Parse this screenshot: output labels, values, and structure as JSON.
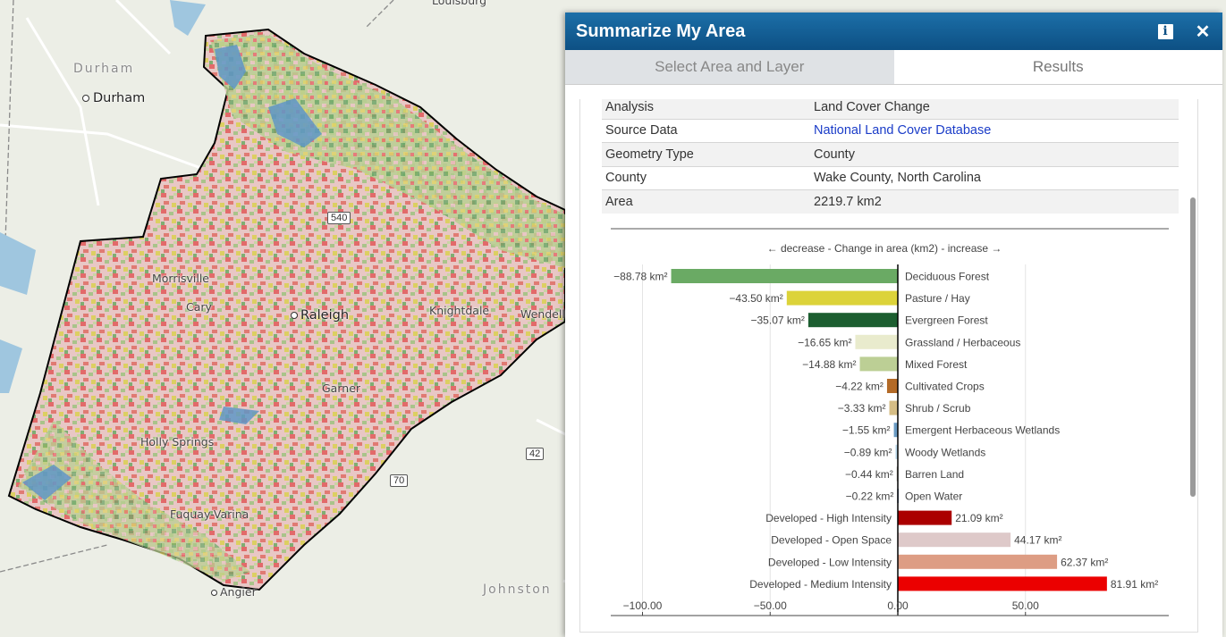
{
  "map": {
    "labels": {
      "durham_region": "Durham",
      "durham_city": "Durham",
      "louisburg": "Louisburg",
      "morrisville": "Morrisville",
      "cary": "Cary",
      "raleigh": "Raleigh",
      "knightdale": "Knightdale",
      "wendell": "Wendell",
      "garner": "Garner",
      "holly_springs": "Holly Springs",
      "fuquay_varina": "Fuquay-Varina",
      "angier": "Angier",
      "johnston": "Johnston"
    },
    "shields": {
      "i540": "540",
      "us70": "70",
      "nc42": "42"
    }
  },
  "panel": {
    "title": "Summarize My Area",
    "info_icon": "info-icon",
    "close_icon": "close-icon",
    "tabs": [
      {
        "label": "Select Area and Layer",
        "active": false
      },
      {
        "label": "Results",
        "active": true
      }
    ]
  },
  "summary": {
    "rows": [
      {
        "key": "Analysis",
        "value": "Land Cover Change",
        "link": false
      },
      {
        "key": "Source Data",
        "value": "National Land Cover Database",
        "link": true
      },
      {
        "key": "Geometry Type",
        "value": "County",
        "link": false
      },
      {
        "key": "County",
        "value": "Wake County, North Carolina",
        "link": false
      },
      {
        "key": "Area",
        "value": "2219.7 km2",
        "link": false
      }
    ]
  },
  "chart_data": {
    "type": "bar",
    "orientation": "horizontal",
    "title": "← decrease - Change in area (km2) - increase →",
    "unit": "km²",
    "xlim": [
      -100,
      100
    ],
    "xticks": [
      -100,
      -50,
      0,
      50
    ],
    "xtick_labels": [
      "−100.00",
      "−50.00",
      "0.00",
      "50.00"
    ],
    "categories": [
      "Deciduous Forest",
      "Pasture / Hay",
      "Evergreen Forest",
      "Grassland / Herbaceous",
      "Mixed Forest",
      "Cultivated Crops",
      "Shrub / Scrub",
      "Emergent Herbaceous Wetlands",
      "Woody Wetlands",
      "Barren Land",
      "Open Water",
      "Developed - High Intensity",
      "Developed - Open Space",
      "Developed - Low Intensity",
      "Developed - Medium Intensity"
    ],
    "values": [
      -88.78,
      -43.5,
      -35.07,
      -16.65,
      -14.88,
      -4.22,
      -3.33,
      -1.55,
      -0.89,
      -0.44,
      -0.22,
      21.09,
      44.17,
      62.37,
      81.91
    ],
    "value_labels": [
      "−88.78 km²",
      "−43.50 km²",
      "−35.07 km²",
      "−16.65 km²",
      "−14.88 km²",
      "−4.22 km²",
      "−3.33 km²",
      "−1.55 km²",
      "−0.89 km²",
      "−0.44 km²",
      "−0.22 km²",
      "21.09 km²",
      "44.17 km²",
      "62.37 km²",
      "81.91 km²"
    ],
    "colors": [
      "#6aaa64",
      "#dcd339",
      "#1c5e30",
      "#e9ebcd",
      "#bccf95",
      "#b36a27",
      "#d5bd85",
      "#6a9bc3",
      "#b8d6e8",
      "#b3ada3",
      "#4a6fa0",
      "#ab0000",
      "#dec9c9",
      "#dd9d84",
      "#eb0000"
    ],
    "grid": true
  }
}
